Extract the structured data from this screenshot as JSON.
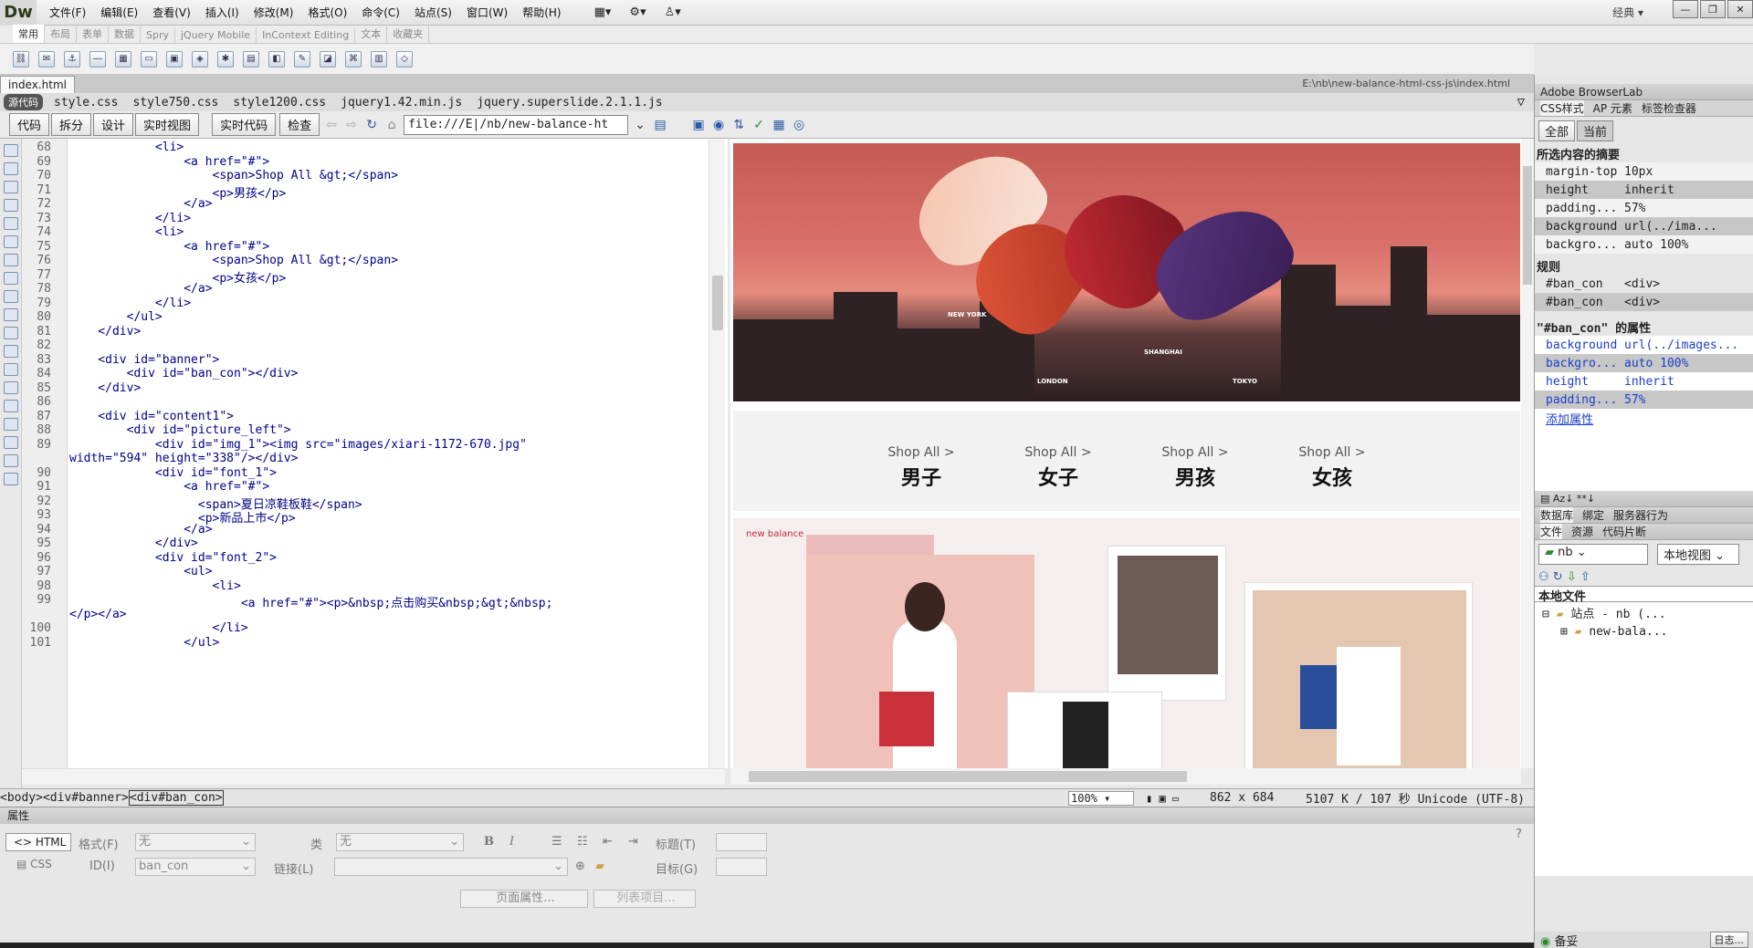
{
  "app": {
    "logo": "Dw",
    "workspace": "经典",
    "workspace_arrow": "▾"
  },
  "menu": [
    "文件(F)",
    "编辑(E)",
    "查看(V)",
    "插入(I)",
    "修改(M)",
    "格式(O)",
    "命令(C)",
    "站点(S)",
    "窗口(W)",
    "帮助(H)"
  ],
  "menu_icons": [
    "▦▾",
    "⚙▾",
    "♙▾"
  ],
  "window_controls": [
    "—",
    "❐",
    "✕"
  ],
  "insert_tabs": [
    "常用",
    "布局",
    "表单",
    "数据",
    "Spry",
    "jQuery Mobile",
    "InContext Editing",
    "文本",
    "收藏夹"
  ],
  "document": {
    "tab": "index.html",
    "path": "E:\\nb\\new-balance-html-css-js\\index.html",
    "source_label": "源代码",
    "related_files": [
      "style.css",
      "style750.css",
      "style1200.css",
      "jquery1.42.min.js",
      "jquery.superslide.2.1.1.js"
    ]
  },
  "doc_toolbar": {
    "buttons": [
      "代码",
      "拆分",
      "设计",
      "实时视图"
    ],
    "live_code": "实时代码",
    "inspect": "检查",
    "url": "file:///E|/nb/new-balance-ht"
  },
  "code": [
    {
      "n": "68",
      "c": "            <li>"
    },
    {
      "n": "69",
      "c": "                <a href=\"#\">"
    },
    {
      "n": "70",
      "c": "                    <span>Shop All &gt;</span>"
    },
    {
      "n": "71",
      "c": "                    <p>男孩</p>"
    },
    {
      "n": "72",
      "c": "                </a>"
    },
    {
      "n": "73",
      "c": "            </li>"
    },
    {
      "n": "74",
      "c": "            <li>"
    },
    {
      "n": "75",
      "c": "                <a href=\"#\">"
    },
    {
      "n": "76",
      "c": "                    <span>Shop All &gt;</span>"
    },
    {
      "n": "77",
      "c": "                    <p>女孩</p>"
    },
    {
      "n": "78",
      "c": "                </a>"
    },
    {
      "n": "79",
      "c": "            </li>"
    },
    {
      "n": "80",
      "c": "        </ul>"
    },
    {
      "n": "81",
      "c": "    </div>"
    },
    {
      "n": "82",
      "c": ""
    },
    {
      "n": "83",
      "c": "    <div id=\"banner\">"
    },
    {
      "n": "84",
      "c": "        <div id=\"ban_con\"></div>"
    },
    {
      "n": "85",
      "c": "    </div>"
    },
    {
      "n": "86",
      "c": ""
    },
    {
      "n": "87",
      "c": "    <div id=\"content1\">"
    },
    {
      "n": "88",
      "c": "        <div id=\"picture_left\">"
    },
    {
      "n": "89",
      "c": "            <div id=\"img_1\"><img src=\"images/xiari-1172-670.jpg\""
    },
    {
      "n": "",
      "c": "width=\"594\" height=\"338\"/></div>"
    },
    {
      "n": "90",
      "c": "            <div id=\"font_1\">"
    },
    {
      "n": "91",
      "c": "                <a href=\"#\">"
    },
    {
      "n": "92",
      "c": "                  <span>夏日凉鞋板鞋</span>"
    },
    {
      "n": "93",
      "c": "                  <p>新品上市</p>"
    },
    {
      "n": "94",
      "c": "                </a>"
    },
    {
      "n": "95",
      "c": "            </div>"
    },
    {
      "n": "96",
      "c": "            <div id=\"font_2\">"
    },
    {
      "n": "97",
      "c": "                <ul>"
    },
    {
      "n": "98",
      "c": "                    <li>"
    },
    {
      "n": "99",
      "c": "                        <a href=\"#\"><p>&nbsp;点击购买&nbsp;&gt;&nbsp;"
    },
    {
      "n": "",
      "c": "</p></a>"
    },
    {
      "n": "100",
      "c": "                    </li>"
    },
    {
      "n": "101",
      "c": "                </ul>"
    }
  ],
  "live": {
    "cities": [
      "NEW YORK",
      "LONDON",
      "SHANGHAI",
      "TOKYO"
    ],
    "shop": [
      {
        "top": "Shop All >",
        "big": "男子"
      },
      {
        "top": "Shop All >",
        "big": "女子"
      },
      {
        "top": "Shop All >",
        "big": "男孩"
      },
      {
        "top": "Shop All >",
        "big": "女孩"
      }
    ],
    "brand": "new balance"
  },
  "status": {
    "tags": [
      "<body>",
      "<div#banner>",
      "<div#ban_con>"
    ],
    "zoom": "100%",
    "size": "862 x 684",
    "info": "5107 K / 107 秒 Unicode (UTF-8)"
  },
  "props": {
    "title": "属性",
    "html": "<> HTML",
    "css": "CSS",
    "format_label": "格式(F)",
    "format_val": "无",
    "class_label": "类",
    "class_val": "无",
    "id_label": "ID(I)",
    "id_val": "ban_con",
    "link_label": "链接(L)",
    "title_label": "标题(T)",
    "target_label": "目标(G)",
    "page_props": "页面属性...",
    "list_item": "列表项目..."
  },
  "panel": {
    "browserlab": "Adobe BrowserLab",
    "tabs": [
      "CSS样式",
      "AP 元素",
      "标签检查器"
    ],
    "buttons": [
      "全部",
      "当前"
    ],
    "summary_title": "所选内容的摘要",
    "summary": [
      [
        "margin-top",
        "10px"
      ],
      [
        "height",
        "inherit"
      ],
      [
        "padding...",
        "57%"
      ],
      [
        "background",
        "url(../ima..."
      ],
      [
        "backgro...",
        "auto 100%"
      ]
    ],
    "rules_title": "规则",
    "rules": [
      [
        "#ban_con",
        "<div>"
      ],
      [
        "#ban_con",
        "<div>"
      ]
    ],
    "props_title": "\"#ban_con\" 的属性",
    "props": [
      [
        "background",
        "url(../images..."
      ],
      [
        "backgro...",
        "auto 100%"
      ],
      [
        "height",
        "inherit"
      ],
      [
        "padding...",
        "57%"
      ]
    ],
    "add_prop": "添加属性",
    "db_tabs": [
      "数据库",
      "绑定",
      "服务器行为"
    ],
    "file_tabs": [
      "文件",
      "资源",
      "代码片断"
    ],
    "site": "nb",
    "view": "本地视图",
    "local_files": "本地文件",
    "tree": [
      "站点 - nb (...",
      "new-bala..."
    ],
    "log": "备妥",
    "log2": "日志..."
  }
}
